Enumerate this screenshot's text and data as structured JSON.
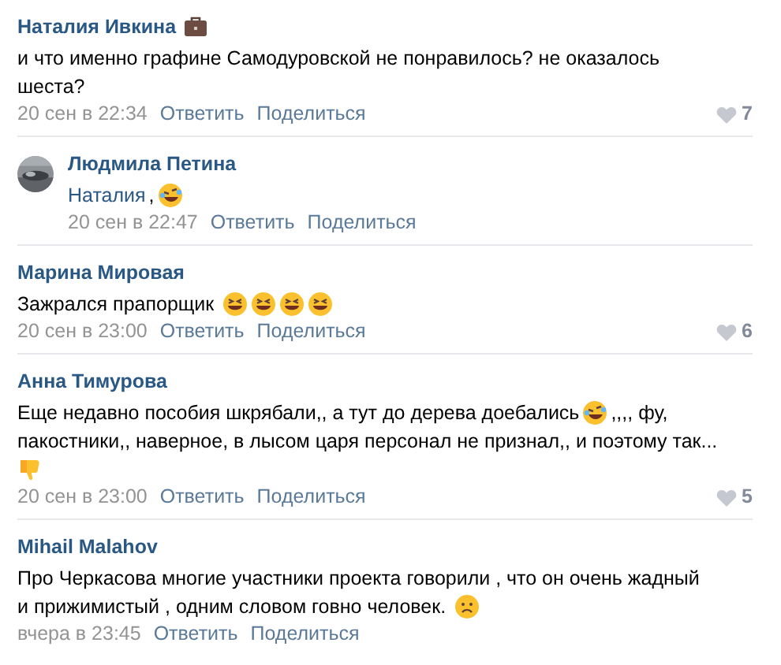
{
  "comments": [
    {
      "kind": "comment",
      "author": "Наталия Ивкина",
      "badge": {
        "kind": "briefcase"
      },
      "lines": [
        [
          {
            "kind": "text",
            "text": "и что именно графине Самодуровской не понравилось? не оказалось"
          }
        ],
        [
          {
            "kind": "text",
            "text": "шеста?"
          }
        ]
      ],
      "date": "20 сен в 22:34",
      "reply_label": "Ответить",
      "share_label": "Поделиться",
      "likes": "7"
    },
    {
      "kind": "reply",
      "author": "Людмила Петина",
      "lines": [
        [
          {
            "kind": "link",
            "text": "Наталия"
          },
          {
            "kind": "text",
            "text": ","
          },
          {
            "kind": "rofl"
          }
        ]
      ],
      "date": "20 сен в 22:47",
      "reply_label": "Ответить",
      "share_label": "Поделиться"
    },
    {
      "kind": "comment",
      "author": "Марина Мировая",
      "lines": [
        [
          {
            "kind": "text",
            "text": "Зажрался прапорщик"
          },
          {
            "kind": "laughing"
          },
          {
            "kind": "laughing"
          },
          {
            "kind": "laughing"
          },
          {
            "kind": "laughing"
          }
        ]
      ],
      "date": "20 сен в 23:00",
      "reply_label": "Ответить",
      "share_label": "Поделиться",
      "likes": "6"
    },
    {
      "kind": "comment",
      "author": "Анна Тимурова",
      "lines": [
        [
          {
            "kind": "text",
            "text": "Еще недавно пособия шкрябали,, а тут до дерева доебались"
          },
          {
            "kind": "rofl"
          },
          {
            "kind": "text",
            "text": ",,,, фу,"
          }
        ],
        [
          {
            "kind": "text",
            "text": "пакостники,, наверное, в лысом царя персонал не признал,, и поэтому так..."
          }
        ],
        [
          {
            "kind": "thumbsdown"
          }
        ]
      ],
      "date": "20 сен в 23:00",
      "reply_label": "Ответить",
      "share_label": "Поделиться",
      "likes": "5"
    },
    {
      "kind": "comment",
      "author": "Mihail Malahov",
      "lines": [
        [
          {
            "kind": "text",
            "text": "Про Черкасова многие участники проекта говорили , что он очень жадный"
          }
        ],
        [
          {
            "kind": "text",
            "text": "и прижимистый , одним словом говно человек."
          },
          {
            "kind": "frown"
          }
        ]
      ],
      "date": "вчера в 23:45",
      "reply_label": "Ответить",
      "share_label": "Поделиться"
    }
  ]
}
